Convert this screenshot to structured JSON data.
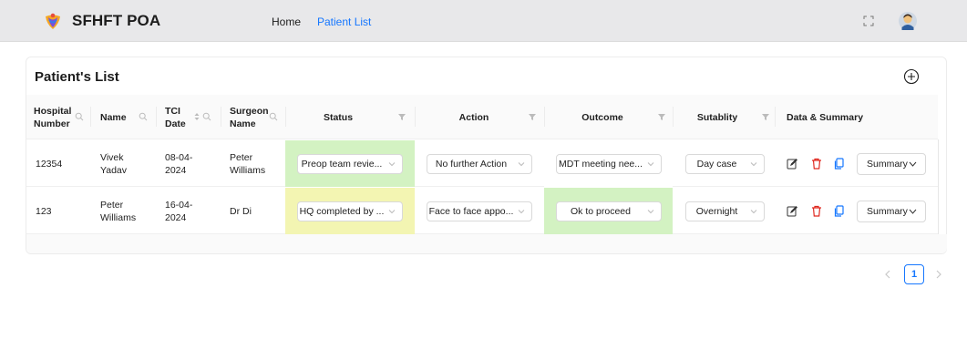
{
  "header": {
    "brand": "SFHFT POA",
    "nav": {
      "home": "Home",
      "patient_list": "Patient List"
    }
  },
  "card": {
    "title": "Patient's List"
  },
  "table": {
    "columns": {
      "hospital_number": "Hospital Number",
      "name": "Name",
      "tci_date": "TCI Date",
      "surgeon_name": "Surgeon Name",
      "status": "Status",
      "action": "Action",
      "outcome": "Outcome",
      "suitability": "Sutablity",
      "data_summary": "Data & Summary"
    },
    "rows": [
      {
        "hospital_number": "12354",
        "name": "Vivek Yadav",
        "tci_date": "08-04-2024",
        "surgeon_name": "Peter Williams",
        "status": "Preop team revie...",
        "action": "No further Action",
        "outcome": "MDT meeting nee...",
        "suitability": "Day case",
        "summary_label": "Summary",
        "status_color": "#d3f2c2",
        "outcome_color": "#ffffff"
      },
      {
        "hospital_number": "123",
        "name": "Peter Williams",
        "tci_date": "16-04-2024",
        "surgeon_name": "Dr Di",
        "status": "HQ completed by ...",
        "action": "Face to face appo...",
        "outcome": "Ok to proceed",
        "suitability": "Overnight",
        "summary_label": "Summary",
        "status_color": "#f3f5b2",
        "outcome_color": "#d3f2c2"
      }
    ]
  },
  "pagination": {
    "current_page": "1"
  },
  "colors": {
    "accent": "#1677ff",
    "delete": "#e0281f",
    "copy": "#1677ff"
  }
}
